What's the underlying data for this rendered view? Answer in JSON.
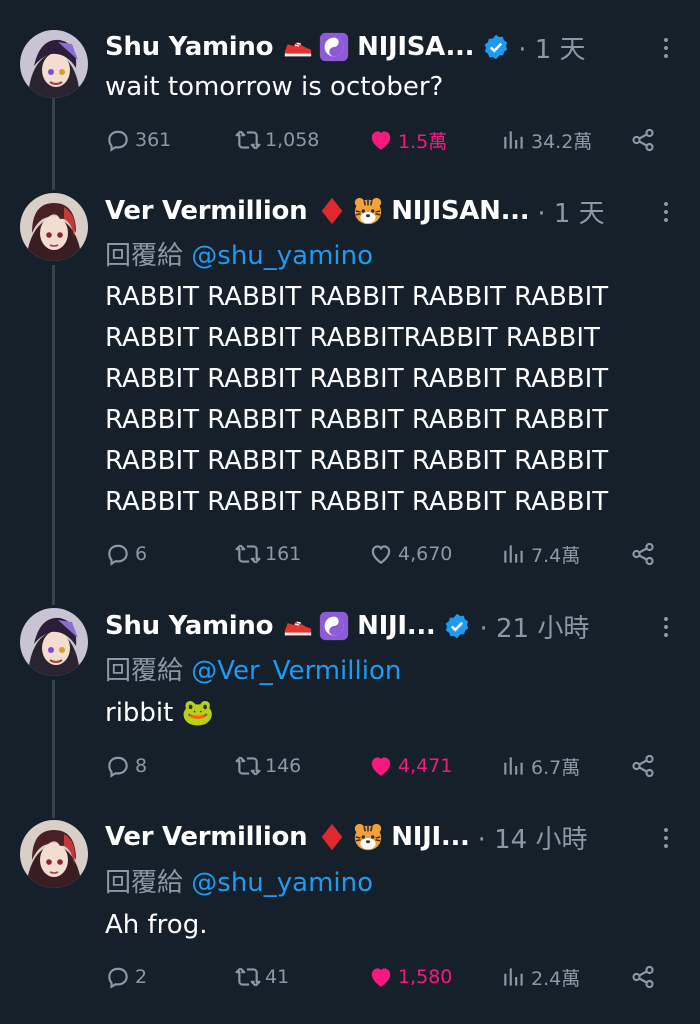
{
  "tweets": [
    {
      "name": "Shu Yamino",
      "tag": "NIJISA...",
      "verified": true,
      "time": "· 1 天",
      "reply_label": "",
      "reply_handle": "",
      "text": "wait tomorrow is october?",
      "stats": {
        "replies": "361",
        "retweets": "1,058",
        "likes": "1.5萬",
        "views": "34.2萬"
      },
      "liked": true
    },
    {
      "name": "Ver Vermillion",
      "tag": "NIJISAN...",
      "verified": false,
      "time": "· 1 天",
      "reply_label": "回覆給",
      "reply_handle": "@shu_yamino",
      "text": "RABBIT RABBIT RABBIT RABBIT RABBIT\nRABBIT RABBIT RABBITRABBIT RABBIT\nRABBIT RABBIT RABBIT RABBIT RABBIT\nRABBIT RABBIT RABBIT RABBIT RABBIT\nRABBIT RABBIT RABBIT RABBIT RABBIT\nRABBIT RABBIT RABBIT RABBIT RABBIT",
      "stats": {
        "replies": "6",
        "retweets": "161",
        "likes": "4,670",
        "views": "7.4萬"
      },
      "liked": false
    },
    {
      "name": "Shu Yamino",
      "tag": "NIJI...",
      "verified": true,
      "time": "· 21 小時",
      "reply_label": "回覆給",
      "reply_handle": "@Ver_Vermillion",
      "text": "ribbit 🐸",
      "stats": {
        "replies": "8",
        "retweets": "146",
        "likes": "4,471",
        "views": "6.7萬"
      },
      "liked": true
    },
    {
      "name": "Ver Vermillion",
      "tag": "NIJI...",
      "verified": false,
      "time": "· 14 小時",
      "reply_label": "回覆給",
      "reply_handle": "@shu_yamino",
      "text": "Ah frog.",
      "stats": {
        "replies": "2",
        "retweets": "41",
        "likes": "1,580",
        "views": "2.4萬"
      },
      "liked": true
    }
  ],
  "colors": {
    "background": "#15202b",
    "secondary_text": "#8b98a5",
    "link": "#1d9bf0",
    "like": "#f91880",
    "thread_line": "#38444d"
  },
  "icons": [
    "reply-icon",
    "retweet-icon",
    "heart-icon",
    "views-icon",
    "share-icon",
    "more-icon",
    "verified-badge-icon"
  ]
}
